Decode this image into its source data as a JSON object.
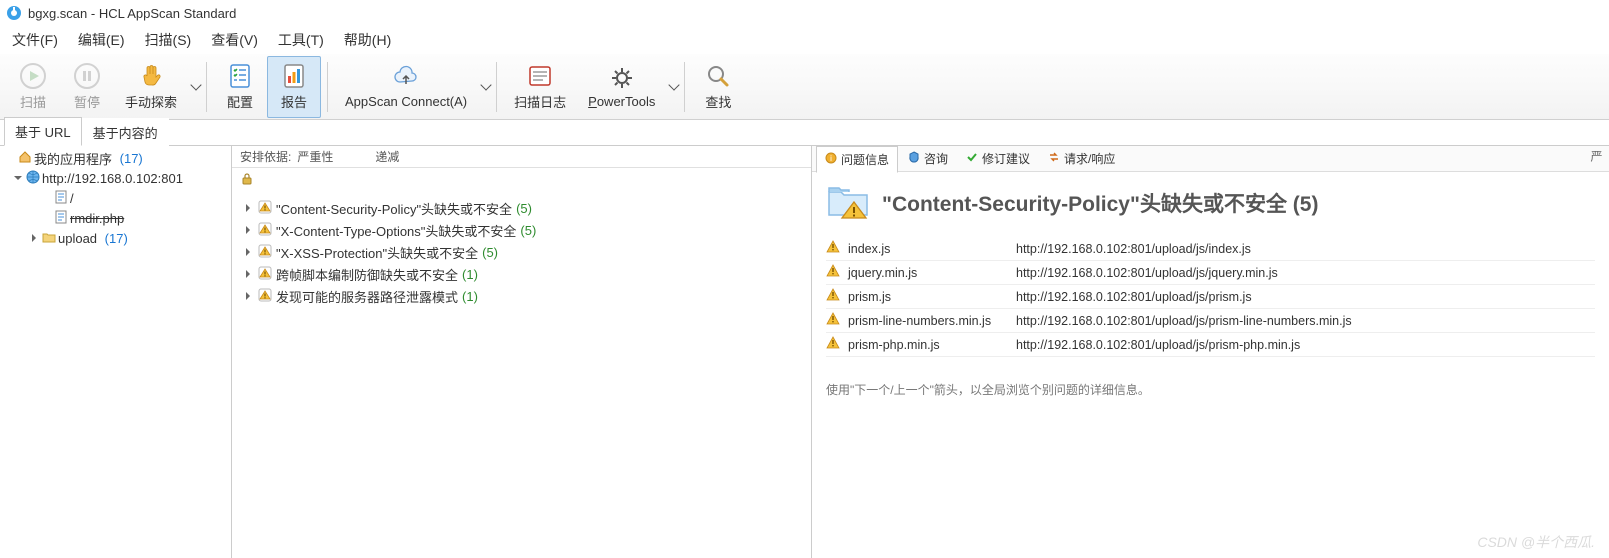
{
  "title_bar": {
    "text": "bgxg.scan - HCL AppScan Standard"
  },
  "menu": {
    "file": "文件(F)",
    "edit": "编辑(E)",
    "scan": "扫描(S)",
    "view": "查看(V)",
    "tools": "工具(T)",
    "help": "帮助(H)"
  },
  "toolbar": {
    "scan": "扫描",
    "pause": "暂停",
    "manual_explore": "手动探索",
    "config": "配置",
    "report": "报告",
    "appscan_connect": "AppScan Connect(A)",
    "scan_log": "扫描日志",
    "powertools": "PowerTools",
    "find": "查找"
  },
  "sub_tabs": {
    "url_based": "基于 URL",
    "content_based": "基于内容的"
  },
  "tree": {
    "root_label": "我的应用程序",
    "root_count": "(17)",
    "host_label": "http://192.168.0.102:801",
    "slash_label": "/",
    "rmdir_label": "rmdir.php",
    "upload_label": "upload",
    "upload_count": "(17)"
  },
  "mid": {
    "sort_label": "安排依据:",
    "severity": "严重性",
    "order": "递减",
    "issues": [
      {
        "label": "\"Content-Security-Policy\"头缺失或不安全",
        "count": "(5)"
      },
      {
        "label": "\"X-Content-Type-Options\"头缺失或不安全",
        "count": "(5)"
      },
      {
        "label": "\"X-XSS-Protection\"头缺失或不安全",
        "count": "(5)"
      },
      {
        "label": "跨帧脚本编制防御缺失或不安全",
        "count": "(1)"
      },
      {
        "label": "发现可能的服务器路径泄露模式",
        "count": "(1)"
      }
    ]
  },
  "detail_tabs": {
    "issue_info": "问题信息",
    "advisory": "咨询",
    "fix": "修订建议",
    "req_resp": "请求/响应"
  },
  "detail": {
    "title": "\"Content-Security-Policy\"头缺失或不安全  (5)",
    "urls": [
      {
        "file": "index.js",
        "url": "http://192.168.0.102:801/upload/js/index.js"
      },
      {
        "file": "jquery.min.js",
        "url": "http://192.168.0.102:801/upload/js/jquery.min.js"
      },
      {
        "file": "prism.js",
        "url": "http://192.168.0.102:801/upload/js/prism.js"
      },
      {
        "file": "prism-line-numbers.min.js",
        "url": "http://192.168.0.102:801/upload/js/prism-line-numbers.min.js"
      },
      {
        "file": "prism-php.min.js",
        "url": "http://192.168.0.102:801/upload/js/prism-php.min.js"
      }
    ],
    "hint": "使用\"下一个/上一个\"箭头，以全局浏览个别问题的详细信息。"
  },
  "side_label": "严",
  "watermark": "CSDN @半个西瓜."
}
